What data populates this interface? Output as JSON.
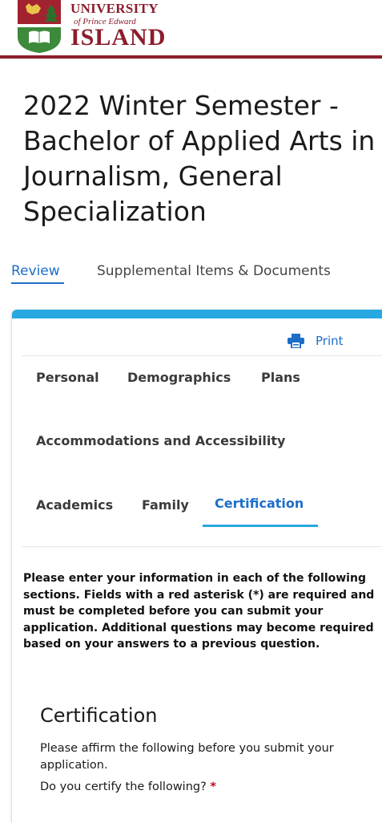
{
  "header": {
    "logo_line1": "UNIVERSITY",
    "logo_line2": "of Prince Edward",
    "logo_line3": "ISLAND",
    "brand_color": "#8c1d2c"
  },
  "page": {
    "title": "2022 Winter Semester - Bachelor of Applied Arts in Journalism, General Specialization"
  },
  "top_tabs": [
    {
      "label": "Review",
      "active": true
    },
    {
      "label": "Supplemental Items & Documents",
      "active": false
    }
  ],
  "card": {
    "accent_color": "#27a8e0",
    "print_label": "Print",
    "print_icon": "printer-icon"
  },
  "section_tabs": [
    {
      "label": "Personal",
      "active": false
    },
    {
      "label": "Demographics",
      "active": false
    },
    {
      "label": "Plans",
      "active": false
    },
    {
      "label": "Accommodations and Accessibility",
      "active": false
    },
    {
      "label": "Academics",
      "active": false
    },
    {
      "label": "Family",
      "active": false
    },
    {
      "label": "Certification",
      "active": true
    }
  ],
  "intro_text": "Please enter your information in each of the following sections. Fields with a red asterisk (*) are required and must be completed before you can submit your application. Additional questions may become required based on your answers to a previous question.",
  "certification": {
    "heading": "Certification",
    "description": "Please affirm the following before you submit your application.",
    "question": "Do you certify the following?",
    "required_marker": "*"
  },
  "colors": {
    "link_blue": "#1d6ec9",
    "required_red": "#d0021b"
  }
}
